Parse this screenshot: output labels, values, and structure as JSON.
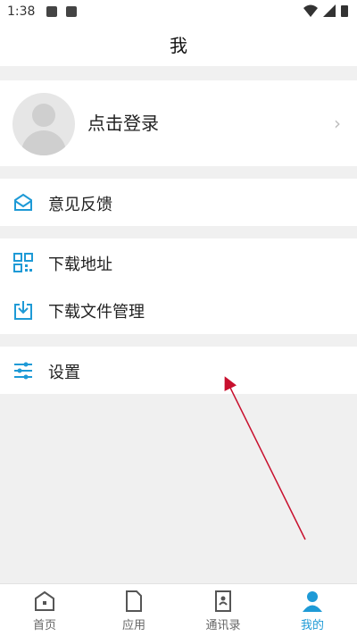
{
  "status_bar": {
    "time": "1:38"
  },
  "header": {
    "title": "我"
  },
  "profile": {
    "login_label": "点击登录"
  },
  "menu": {
    "feedback": "意见反馈",
    "download_address": "下载地址",
    "download_files": "下载文件管理",
    "settings": "设置"
  },
  "tabs": [
    {
      "label": "首页",
      "icon": "home-icon"
    },
    {
      "label": "应用",
      "icon": "document-icon"
    },
    {
      "label": "通讯录",
      "icon": "contacts-icon"
    },
    {
      "label": "我的",
      "icon": "person-icon",
      "active": true
    }
  ],
  "colors": {
    "accent": "#1e9ad6",
    "annotation_arrow": "#c8102e"
  }
}
